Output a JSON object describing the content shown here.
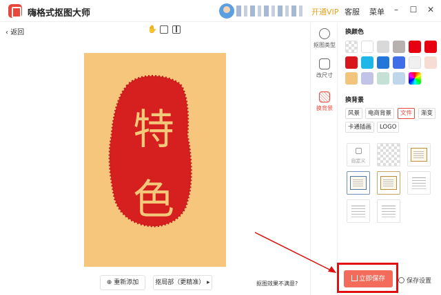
{
  "app": {
    "title": "嗨格式抠图大师",
    "vip_label": "开通VIP",
    "service_label": "客服",
    "menu_label": "菜单"
  },
  "window": {
    "minimize": "–",
    "maximize": "☐",
    "close": "✕"
  },
  "canvas": {
    "back_label": "返回",
    "seal_chars": [
      "特",
      "色"
    ],
    "readd_label": "重新添加",
    "local_label": "抠局部（更精准）",
    "hint": "抠图效果不满意?"
  },
  "toolstrip": {
    "items": [
      {
        "label": "抠图类型"
      },
      {
        "label": "改尺寸"
      },
      {
        "label": "换背景"
      }
    ]
  },
  "panel": {
    "color_title": "换颜色",
    "colors": [
      "transparent",
      "#ffffff",
      "#d9d9d9",
      "#b7b2b0",
      "#e60012",
      "#e60012",
      "#d8161b",
      "#1fb6e8",
      "#2277d8",
      "#3f6ee6",
      "#f0f0f0",
      "#f6dcd2",
      "#f3c47c",
      "#c1c4e6",
      "#c5e0d5",
      "#bfd7ea",
      "rainbow"
    ],
    "bg_title": "换背景",
    "bg_tags": [
      "风景",
      "电商背景",
      "文件",
      "渐变",
      "卡通插画",
      "LOGO"
    ],
    "active_tag": "文件",
    "custom_label": "自定义",
    "save_label": "立即保存",
    "save_settings_label": "保存设置"
  }
}
